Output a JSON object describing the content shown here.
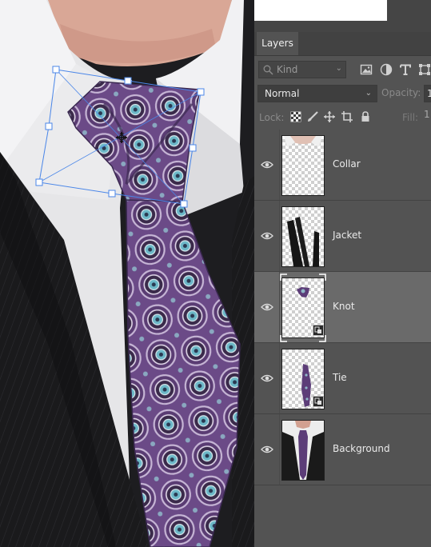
{
  "panel": {
    "tab_label": "Layers",
    "filter": {
      "placeholder": "Kind",
      "icons": [
        "search-icon",
        "image-filter-icon",
        "adjustment-filter-icon",
        "type-filter-icon",
        "shape-filter-icon"
      ]
    },
    "blend_mode": "Normal",
    "opacity_label": "Opacity:",
    "opacity_value": "1",
    "lock_label": "Lock:",
    "lock_icons": [
      "lock-transparent-pixels-icon",
      "lock-image-pixels-icon",
      "lock-position-icon",
      "lock-artboard-icon",
      "lock-all-icon"
    ],
    "fill_label": "Fill:",
    "fill_value": "1",
    "layers": [
      {
        "name": "Collar",
        "visible": true,
        "selected": false,
        "smart_object": false
      },
      {
        "name": "Jacket",
        "visible": true,
        "selected": false,
        "smart_object": false
      },
      {
        "name": "Knot",
        "visible": true,
        "selected": true,
        "smart_object": true
      },
      {
        "name": "Tie",
        "visible": true,
        "selected": false,
        "smart_object": true
      },
      {
        "name": "Background",
        "visible": true,
        "selected": false,
        "smart_object": false
      }
    ]
  },
  "colors": {
    "panel_bg": "#535353",
    "selected_row": "#6a6a6a",
    "transform_box": "#3d7fe0",
    "tie_purple": "#6a4a86"
  }
}
